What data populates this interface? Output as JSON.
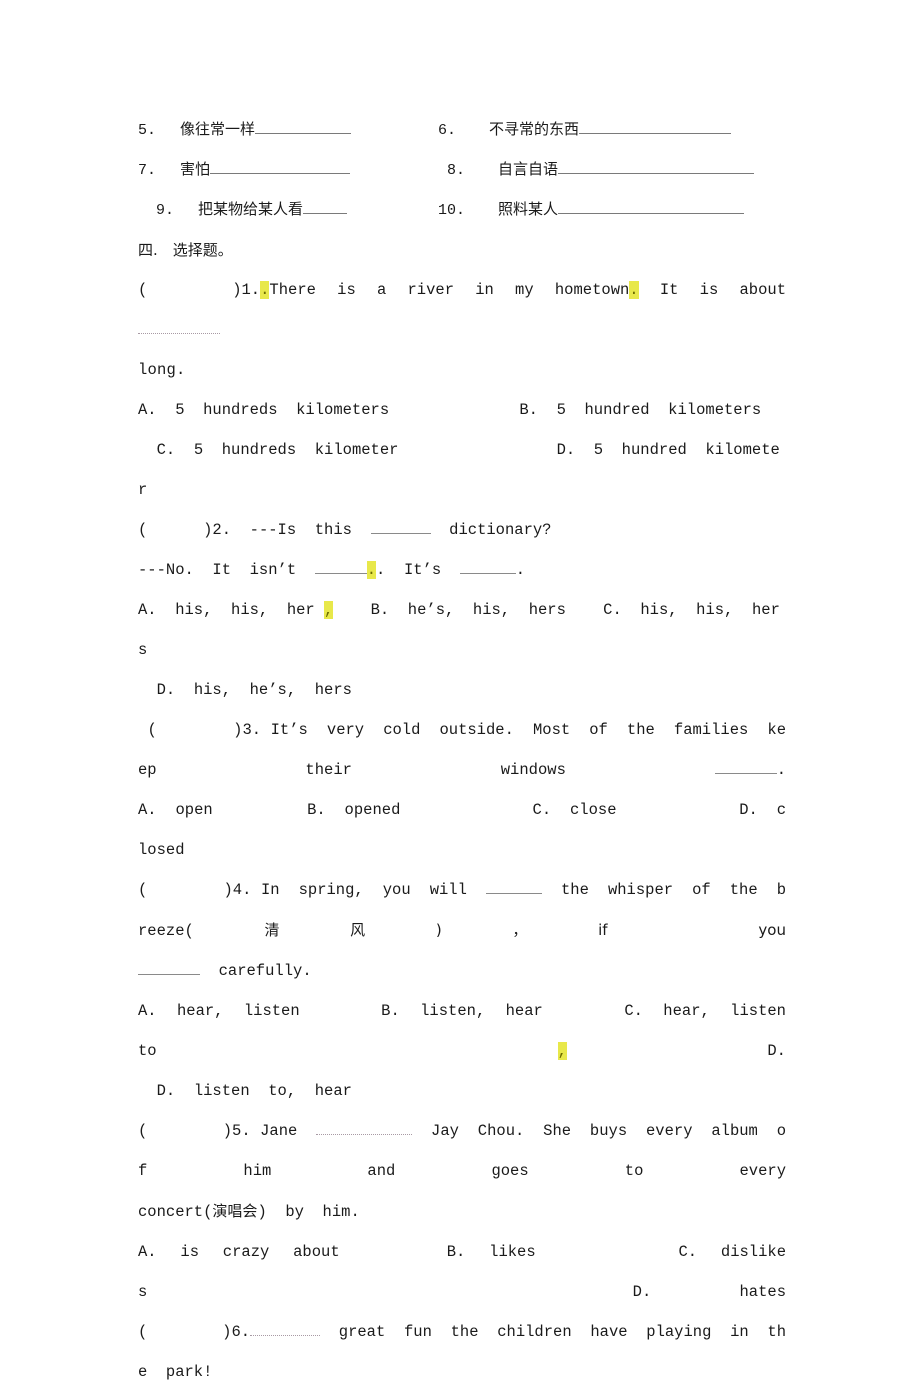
{
  "document": {
    "type": "exam-worksheet",
    "language": "zh-CN/en"
  },
  "vocabulary": {
    "rows": [
      {
        "left": {
          "num": "5.",
          "text": "像往常一样",
          "blank_width": 96
        },
        "right": {
          "num": "6.",
          "text": "不寻常的东西",
          "blank_width": 152
        }
      },
      {
        "left": {
          "num": "7.",
          "text": "害怕",
          "blank_width": 140
        },
        "right": {
          "num": "8.",
          "text": "自言自语",
          "blank_width": 196
        }
      },
      {
        "left": {
          "num": "9.",
          "text": "把某物给某人看",
          "blank_width": 44
        },
        "right": {
          "num": "10.",
          "text": "照料某人",
          "blank_width": 186
        }
      }
    ]
  },
  "section": {
    "heading": "四.　选择题。"
  },
  "questions": [
    {
      "number": "1.",
      "marker": "(        )",
      "stem_parts": [
        {
          "t": "There  is  a  river  in  my  hometown"
        },
        {
          "t": ".",
          "highlight": true
        },
        {
          "t": "  It  is  about  "
        },
        {
          "blank": 82,
          "style": "dotted"
        }
      ],
      "stem_tail": "long.",
      "prefix_dot": {
        "t": ".",
        "highlight": true
      },
      "options_lines": [
        "A.  5  hundreds  kilometers              B.  5  hundred  kilometers",
        "  C.  5  hundreds  kilometer                 D.  5  hundred  kilometer"
      ]
    },
    {
      "number": "2.",
      "marker": "(      )",
      "stem_line_1_pre": "---Is  this  ",
      "stem_line_1_blank": 60,
      "stem_line_1_post": "  dictionary?",
      "stem_line_2_a": "---No.  It  isn’t  ",
      "stem_line_2_blank": 52,
      "stem_line_2_hl": ".",
      "stem_line_2_b": ".  It’s  ",
      "stem_line_2_blank2": 56,
      "stem_line_2_c": ".",
      "options_lines": [
        "A.  his,  his,  her",
        "B.  he’s,  his,  hers",
        "C.  his,  his,  hers",
        "  D.  his,  he’s,  hers"
      ],
      "options_hl_comma": ","
    },
    {
      "number": "3.",
      "marker": "(        )",
      "stem": "It’s  very  cold  outside.  Most  of  the  families  keep  their  windows  ",
      "stem_blank": 62,
      "stem_end": ".",
      "options_lines": [
        "A.  open",
        "B.  opened",
        "C.  close",
        "D.  closed"
      ]
    },
    {
      "number": "4.",
      "marker": "(        )",
      "stem_a": "In  spring,  you  will  ",
      "stem_blank1": 56,
      "stem_b": "  the  whisper  of  the  breeze(",
      "stem_cn": "清风",
      "stem_c": ")，if  you",
      "stem_line3_blank": 62,
      "stem_line3": "  carefully.",
      "options_lines": [
        "A.  hear,  listen",
        "B.  listen,  hear",
        "C.  hear,  listen  to",
        "D.  listen  to,  hear"
      ],
      "options_hl_comma": ","
    },
    {
      "number": "5.",
      "marker": "(        )",
      "stem_a": "Jane  ",
      "stem_blank": 96,
      "stem_b": "  Jay  Chou.  She  buys  every  album  of  him  and  goes  to  every",
      "stem_line3_a": "concert(",
      "stem_line3_cn": "演唱会",
      "stem_line3_b": ")  by  him.",
      "options_lines": [
        "A.  is  crazy  about",
        "B.  likes",
        "C.  dislikes",
        "D.  hates"
      ]
    },
    {
      "number": "6.",
      "marker": "(        )",
      "stem_blank": 70,
      "stem": "  great  fun  the  children  have  playing  in  the  park!"
    }
  ]
}
